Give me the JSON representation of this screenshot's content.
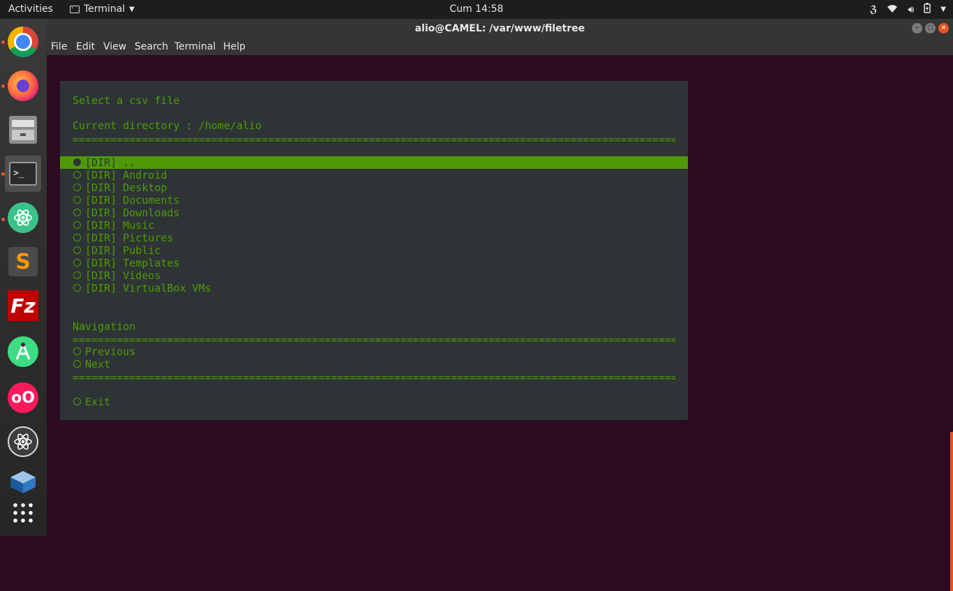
{
  "topbar": {
    "activities": "Activities",
    "app_name": "Terminal",
    "clock": "Cum 14:58"
  },
  "window": {
    "title": "alio@CAMEL: /var/www/filetree",
    "menu": [
      "File",
      "Edit",
      "View",
      "Search",
      "Terminal",
      "Help"
    ]
  },
  "dock": {
    "items": [
      {
        "icon": "chrome-icon",
        "running": true
      },
      {
        "icon": "firefox-icon",
        "running": true
      },
      {
        "icon": "files-icon",
        "running": false
      },
      {
        "icon": "terminal-icon",
        "running": true,
        "active": true
      },
      {
        "icon": "atom-icon",
        "running": true
      },
      {
        "icon": "sublime-text-icon",
        "running": false
      },
      {
        "icon": "filezilla-icon",
        "running": false
      },
      {
        "icon": "android-studio-icon",
        "running": false
      },
      {
        "icon": "flickr-icon",
        "running": false
      },
      {
        "icon": "react-icon",
        "running": false
      },
      {
        "icon": "virtualbox-icon",
        "running": false
      },
      {
        "icon": "show-apps-icon",
        "running": false
      }
    ]
  },
  "tui": {
    "heading": "Select a csv file",
    "current_dir": "Current directory : /home/alio",
    "separator": "==================================================================================================",
    "entries": [
      {
        "label": "[DIR] ..",
        "selected": true
      },
      {
        "label": "[DIR] Android",
        "selected": false
      },
      {
        "label": "[DIR] Desktop",
        "selected": false
      },
      {
        "label": "[DIR] Documents",
        "selected": false
      },
      {
        "label": "[DIR] Downloads",
        "selected": false
      },
      {
        "label": "[DIR] Music",
        "selected": false
      },
      {
        "label": "[DIR] Pictures",
        "selected": false
      },
      {
        "label": "[DIR] Public",
        "selected": false
      },
      {
        "label": "[DIR] Templates",
        "selected": false
      },
      {
        "label": "[DIR] Videos",
        "selected": false
      },
      {
        "label": "[DIR] VirtualBox VMs",
        "selected": false
      }
    ],
    "navigation_heading": "Navigation",
    "nav_items": [
      "Previous",
      "Next"
    ],
    "exit_label": "Exit"
  },
  "colors": {
    "accent_green": "#4e9a06",
    "panel_bg": "#2e3436",
    "terminal_bg": "#2c0a22",
    "ubuntu_orange": "#e95420"
  }
}
